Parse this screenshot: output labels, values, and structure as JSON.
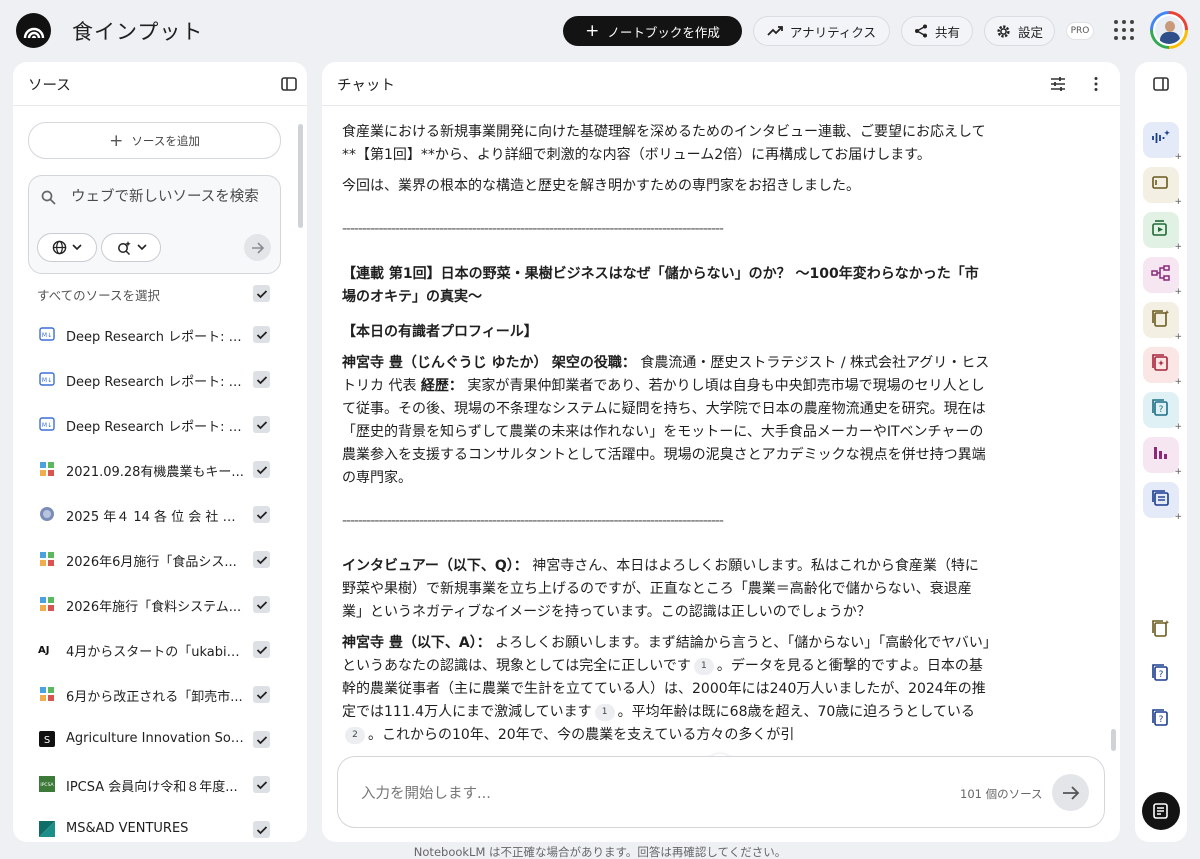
{
  "header": {
    "app_title": "食インプット",
    "create_notebook_label": "ノートブックを作成",
    "analytics_label": "アナリティクス",
    "share_label": "共有",
    "settings_label": "設定",
    "pro_badge": "PRO"
  },
  "sources": {
    "title": "ソース",
    "add_label": "ソースを追加",
    "search_placeholder": "ウェブで新しいソースを検索",
    "select_all_label": "すべてのソースを選択",
    "items": [
      {
        "label": "Deep Research レポート: 大...",
        "icon": "deep-research-icon"
      },
      {
        "label": "Deep Research レポート: 我...",
        "icon": "deep-research-icon"
      },
      {
        "label": "Deep Research レポート: 日...",
        "icon": "deep-research-icon"
      },
      {
        "label": "2021.09.28有機農業もキー...",
        "icon": "site-favicon"
      },
      {
        "label": "2025 年４ 14 各 位 会 社 名 ...",
        "icon": "globe-favicon"
      },
      {
        "label": "2026年6月施行「食品シス...",
        "icon": "site-favicon"
      },
      {
        "label": "2026年施行「食料システム...",
        "icon": "site-favicon"
      },
      {
        "label": "4月からスタートの「ukabis...",
        "icon": "aj-favicon"
      },
      {
        "label": "6月から改正される「卸売市...",
        "icon": "site-favicon"
      },
      {
        "label": "Agriculture Innovation Solut...",
        "icon": "s-favicon"
      },
      {
        "label": "IPCSA 会員向け令和８年度...",
        "icon": "ipcsa-favicon"
      },
      {
        "label": "MS&AD VENTURES",
        "icon": "msad-favicon"
      }
    ]
  },
  "chat": {
    "title": "チャット",
    "intro_1": "食産業における新規事業開発に向けた基礎理解を深めるためのインタビュー連載、ご要望にお応えして**【第1回】**から、より詳細で刺激的な内容（ボリューム2倍）に再構成してお届けします。",
    "intro_2": "今回は、業界の根本的な構造と歴史を解き明かすための専門家をお招きしました。",
    "divider_1": "----------------------------------------------------------------------------------------------",
    "heading": "【連載 第1回】日本の野菜・果樹ビジネスはなぜ「儲からない」のか？ 〜100年変わらなかった「市場のオキテ」の真実〜",
    "profile_heading": "【本日の有識者プロフィール】",
    "profile_name": "神宮寺 豊（じんぐうじ ゆたか）",
    "profile_role_label": "架空の役職：",
    "profile_role": "食農流通・歴史ストラテジスト / 株式会社アグリ・ヒストリカ 代表",
    "profile_history_label": "経歴：",
    "profile_history": "実家が青果仲卸業者であり、若かりし頃は自身も中央卸売市場で現場のセリ人として従事。その後、現場の不条理なシステムに疑問を持ち、大学院で日本の農産物流通史を研究。現在は「歴史的背景を知らずして農業の未来は作れない」をモットーに、大手食品メーカーやITベンチャーの農業参入を支援するコンサルタントとして活躍中。現場の泥臭さとアカデミックな視点を併せ持つ異端の専門家。",
    "divider_2": "----------------------------------------------------------------------------------------------",
    "q_label": "インタビュアー（以下、Q）：",
    "q_text": "神宮寺さん、本日はよろしくお願いします。私はこれから食産業（特に野菜や果樹）で新規事業を立ち上げるのですが、正直なところ「農業＝高齢化で儲からない、衰退産業」というネガティブなイメージを持っています。この認識は正しいのでしょうか？",
    "a_label": "神宮寺 豊（以下、A）：",
    "a_text_1": "よろしくお願いします。まず結論から言うと、「儲からない」「高齢化でヤバい」というあなたの認識は、現象としては完全に正しいです",
    "a_cite_1": "1",
    "a_text_2": "。データを見ると衝撃的ですよ。日本の基幹的農業従事者（主に農業で生計を立てている人）は、2000年には240万人いましたが、2024年の推定では111.4万人にまで激減しています",
    "a_cite_2": "1",
    "a_text_3": "。平均年齢は既に68歳を超え、70歳に迫ろうとしている",
    "a_cite_3": "2",
    "a_text_4": "。これからの10年、20年で、今の農業を支えている方々の多くが引",
    "composer_placeholder": "入力を開始します...",
    "source_count": "101 個のソース"
  },
  "footer": {
    "disclaimer": "NotebookLM は不正確な場合があります。回答は再確認してください。"
  },
  "studio": {
    "tools": [
      {
        "icon": "audio-overview-icon",
        "bg": "#e4eaf8",
        "fg": "#1a3d8f"
      },
      {
        "icon": "slides-icon",
        "bg": "#f3efe2",
        "fg": "#6b5a1e"
      },
      {
        "icon": "video-overview-icon",
        "bg": "#e1f1e4",
        "fg": "#1f6a34"
      },
      {
        "icon": "mindmap-icon",
        "bg": "#f5e6f2",
        "fg": "#8a2a78"
      },
      {
        "icon": "report-icon",
        "bg": "#f3efe2",
        "fg": "#6b5a1e"
      },
      {
        "icon": "flashcards-icon",
        "bg": "#fbe6e6",
        "fg": "#a8233a"
      },
      {
        "icon": "quiz-icon",
        "bg": "#e0f1f6",
        "fg": "#1b6f86"
      },
      {
        "icon": "infographic-icon",
        "bg": "#f5e6f2",
        "fg": "#8a2a78"
      },
      {
        "icon": "data-table-icon",
        "bg": "#e4eaf8",
        "fg": "#1a3d8f"
      }
    ],
    "notes": [
      {
        "icon": "report-note-icon",
        "fg": "#6b5a1e"
      },
      {
        "icon": "quiz-note-icon",
        "fg": "#1a3d8f"
      },
      {
        "icon": "quiz-note-icon",
        "fg": "#1a3d8f"
      }
    ]
  }
}
